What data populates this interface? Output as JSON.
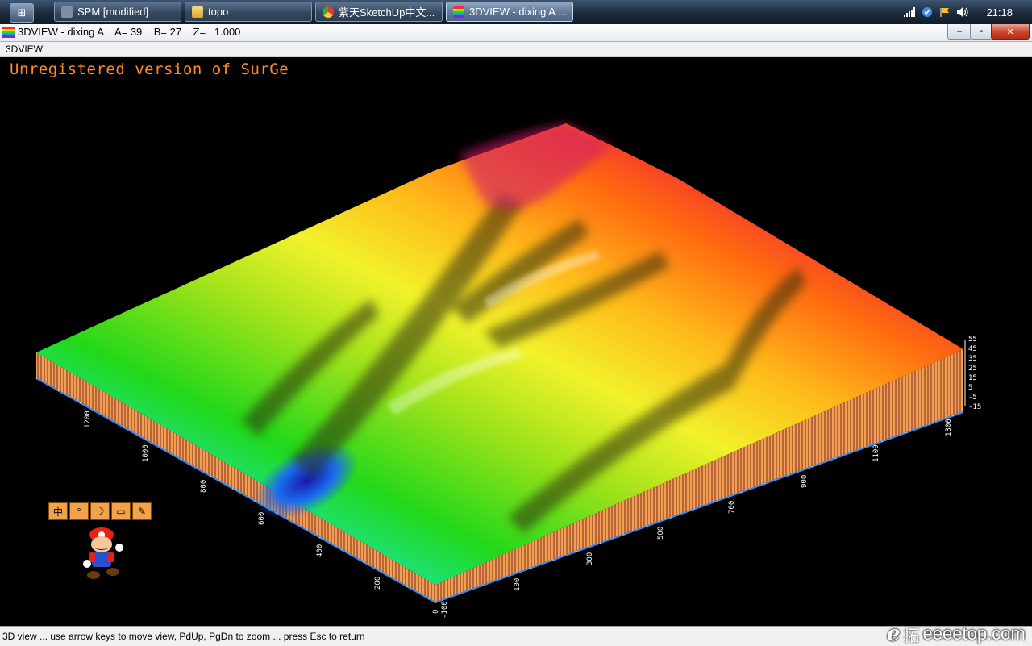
{
  "taskbar": {
    "start_icon": "windows-logo",
    "tasks": [
      {
        "label": "SPM [modified]",
        "icon": "spm-icon",
        "active": false
      },
      {
        "label": "topo",
        "icon": "folder-icon",
        "active": false
      },
      {
        "label": "紫天SketchUp中文...",
        "icon": "chrome-icon",
        "active": false
      },
      {
        "label": "3DVIEW - dixing A ...",
        "icon": "surfer-icon",
        "active": true
      }
    ],
    "clock": "21:18"
  },
  "window": {
    "title": "3DVIEW - dixing A    A= 39    B= 27    Z=   1.000",
    "menu_label": "3DVIEW",
    "minimize": "–",
    "maximize": "▫",
    "close": "✕"
  },
  "viewport": {
    "watermark": "Unregistered version of SurGe",
    "left_axis_labels": [
      "1200",
      "1000",
      "800",
      "600",
      "400",
      "200",
      "0"
    ],
    "right_axis_labels": [
      "-100",
      "100",
      "300",
      "500",
      "700",
      "900",
      "1100",
      "1300"
    ],
    "color_scale_labels": [
      "55",
      "45",
      "35",
      "25",
      "15",
      "5",
      "-5",
      "-15"
    ],
    "ime_buttons": [
      "中",
      "°",
      "☽",
      "▭",
      "✎"
    ]
  },
  "status": {
    "text": "3D view ... use arrow keys to move view, PdUp, PgDn to zoom ... press Esc to return"
  },
  "site_logo": {
    "mark": "e",
    "mark2": "拓",
    "domain": "eeeetop.com"
  }
}
